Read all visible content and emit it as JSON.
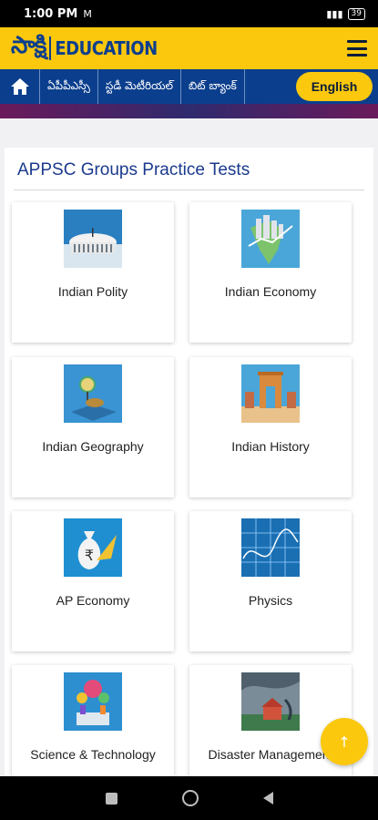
{
  "status": {
    "time": "1:00 PM",
    "app_indicator": "M",
    "battery": "39"
  },
  "header": {
    "logo_telugu": "సాక్షి",
    "logo_text": "EDUCATION"
  },
  "nav": {
    "items": [
      "ఏపీపీఎస్సీ",
      "స్టడీ మెటీరియల్",
      "బిట్ బ్యాంక్"
    ],
    "language_button": "English"
  },
  "section": {
    "title": "APPSC Groups Practice Tests",
    "tiles": [
      {
        "label": "Indian Polity",
        "icon": "parliament-image"
      },
      {
        "label": "Indian Economy",
        "icon": "economy-image"
      },
      {
        "label": "Indian Geography",
        "icon": "globe-image"
      },
      {
        "label": "Indian History",
        "icon": "india-gate-image"
      },
      {
        "label": "AP Economy",
        "icon": "rupee-bag-image"
      },
      {
        "label": "Physics",
        "icon": "physics-image"
      },
      {
        "label": "Science & Technology",
        "icon": "science-image"
      },
      {
        "label": "Disaster Management",
        "icon": "disaster-image"
      }
    ]
  },
  "fab": {
    "label": "↑"
  },
  "colors": {
    "brand_yellow": "#fbc80e",
    "brand_blue": "#0b3e8d",
    "title_blue": "#1b3a8e"
  }
}
